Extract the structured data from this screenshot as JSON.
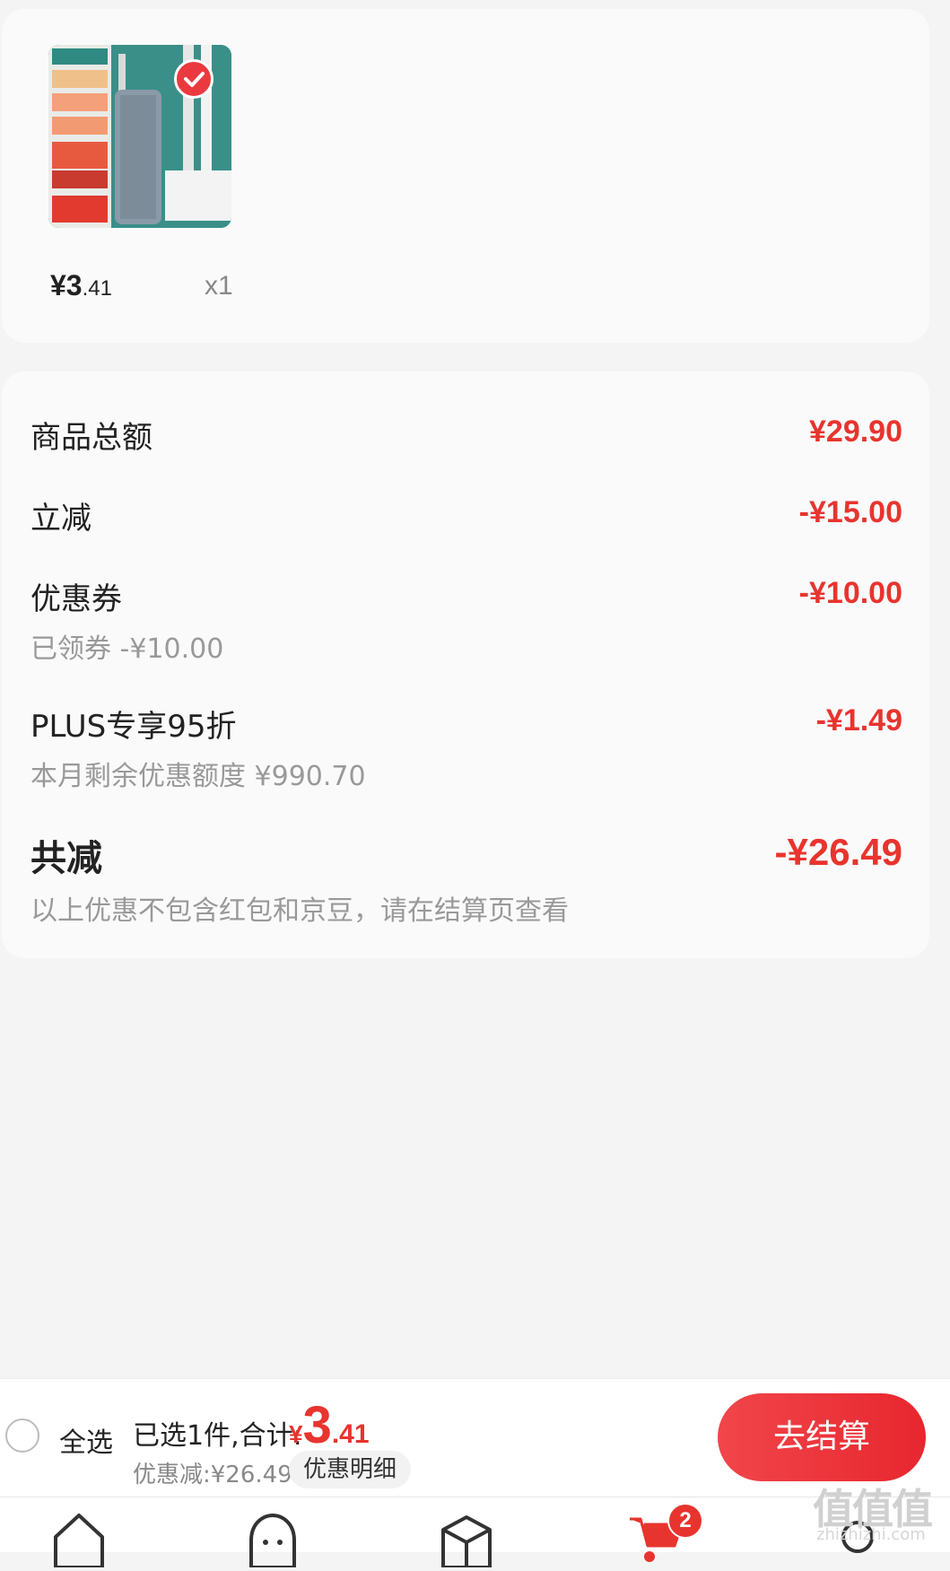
{
  "product": {
    "price_int": "¥3",
    "price_dec": ".41",
    "quantity": "x1",
    "image_icon": "mop-product-image"
  },
  "summary": {
    "rows": [
      {
        "label": "商品总额",
        "value": "¥29.90"
      },
      {
        "label": "立减",
        "value": "-¥15.00"
      },
      {
        "label": "优惠券",
        "value": "-¥10.00",
        "sub": "已领券 -¥10.00"
      },
      {
        "label": "PLUS专享95折",
        "value": "-¥1.49",
        "sub": "本月剩余优惠额度 ¥990.70"
      }
    ],
    "total_label": "共减",
    "total_value": "-¥26.49",
    "note": "以上优惠不包含红包和京豆，请在结算页查看"
  },
  "bottom_bar": {
    "select_all": "全选",
    "selected": "已选1件,合计:",
    "total_yen": "¥",
    "total_int": "3",
    "total_dec": ".41",
    "discount": "优惠减:¥26.49",
    "detail": "优惠明细",
    "checkout": "去结算"
  },
  "tab_bar": {
    "cart_badge": "2"
  },
  "watermark": {
    "main": "值值值",
    "sub": "zhizhizhi.com"
  },
  "colors": {
    "accent": "#e8342e",
    "background": "#f4f4f4",
    "card": "#fafafa"
  }
}
